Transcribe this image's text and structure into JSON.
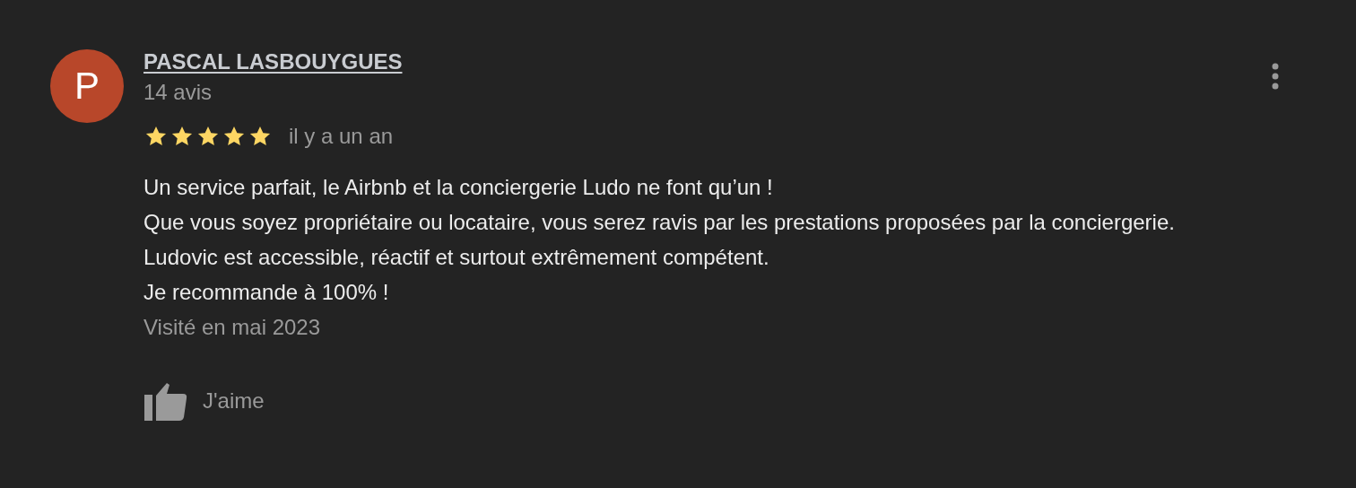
{
  "review": {
    "author": "PASCAL LASBOUYGUES",
    "avatar_letter": "P",
    "review_count": "14 avis",
    "stars": 5,
    "date": "il y a un an",
    "body": [
      "Un service parfait, le Airbnb et la conciergerie Ludo ne font qu’un !",
      "Que vous soyez propriétaire ou locataire, vous serez ravis par les prestations proposées par la conciergerie.",
      "Ludovic est accessible, réactif et surtout extrêmement compétent.",
      "Je recommande à 100% !"
    ],
    "visited": "Visité en mai 2023",
    "like_label": "J'aime",
    "liked": false
  }
}
